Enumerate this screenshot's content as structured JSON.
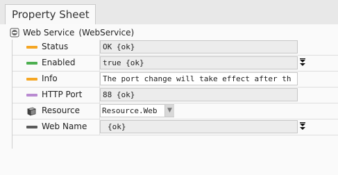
{
  "tab": {
    "label": "Property Sheet"
  },
  "root": {
    "name": "Web Service",
    "type": "(WebService)"
  },
  "rows": [
    {
      "label": "Status",
      "value": "OK {ok}",
      "swatch_color": "#f5a623"
    },
    {
      "label": "Enabled",
      "value": "true {ok}",
      "swatch_color": "#4caf50"
    },
    {
      "label": "Info",
      "value": "The port change will take effect after th",
      "swatch_color": "#f5a623"
    },
    {
      "label": "HTTP Port",
      "value": "88 {ok}",
      "swatch_color": "#b98ad1"
    },
    {
      "label": "Resource",
      "value": "Resource.Web",
      "icon": "cube-icon"
    },
    {
      "label": "Web Name",
      "value": " {ok}",
      "swatch_color": "#5a5a5a"
    }
  ],
  "icons": {
    "root": "service-icon",
    "expand": "double-chevron-down-icon",
    "dropdown": "chevron-down-icon"
  }
}
